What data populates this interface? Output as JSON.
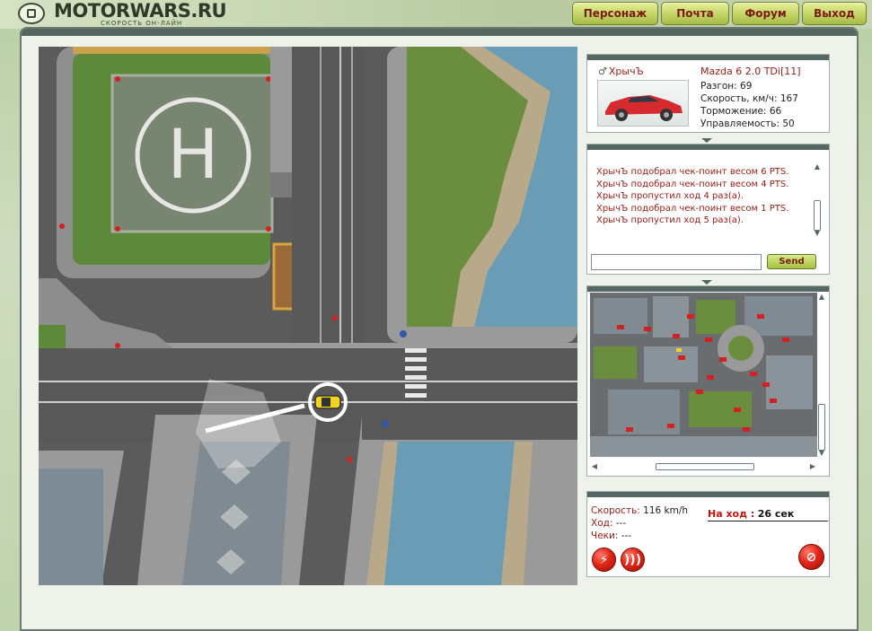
{
  "site": {
    "logo_text": "MOTORWARS.RU",
    "logo_sub": "СКОРОСТЬ ОН-ЛАЙН"
  },
  "nav": [
    {
      "label": "Персонаж"
    },
    {
      "label": "Почта"
    },
    {
      "label": "Форум"
    },
    {
      "label": "Выход"
    }
  ],
  "player": {
    "name": "ХрычЪ",
    "car": "Mazda 6 2.0 TDi[11]",
    "car_color": "#d62a2f",
    "stats": [
      {
        "label": "Разгон",
        "value": "69"
      },
      {
        "label": "Скорость, км/ч",
        "value": "167"
      },
      {
        "label": "Торможение",
        "value": "66"
      },
      {
        "label": "Управляемость",
        "value": "50"
      }
    ]
  },
  "chat": {
    "messages": [
      "ХрычЪ подобрал чек-поинт весом 6 PTS.",
      "ХрычЪ подобрал чек-поинт весом 4 PTS.",
      "ХрычЪ пропустил ход 4 раз(а).",
      "ХрычЪ подобрал чек-поинт весом 1 PTS.",
      "ХрычЪ пропустил ход 5 раз(а)."
    ],
    "input_value": "",
    "send_label": "Send"
  },
  "status": {
    "speed_label": "Скорость:",
    "speed_value": "116 km/h",
    "move_label": "Ход:",
    "move_value": "---",
    "checks_label": "Чеки:",
    "checks_value": "---",
    "turn_label": "На ход :",
    "turn_value": "26 сек"
  },
  "icons": {
    "player": "gender-male-icon",
    "nitro": "lightning-icon",
    "signal": "radio-signal-icon",
    "stop": "stop-icon"
  },
  "colors": {
    "accent_red": "#9c1a13",
    "panel_bar": "#566863",
    "nav_button": "#c9d86c"
  }
}
